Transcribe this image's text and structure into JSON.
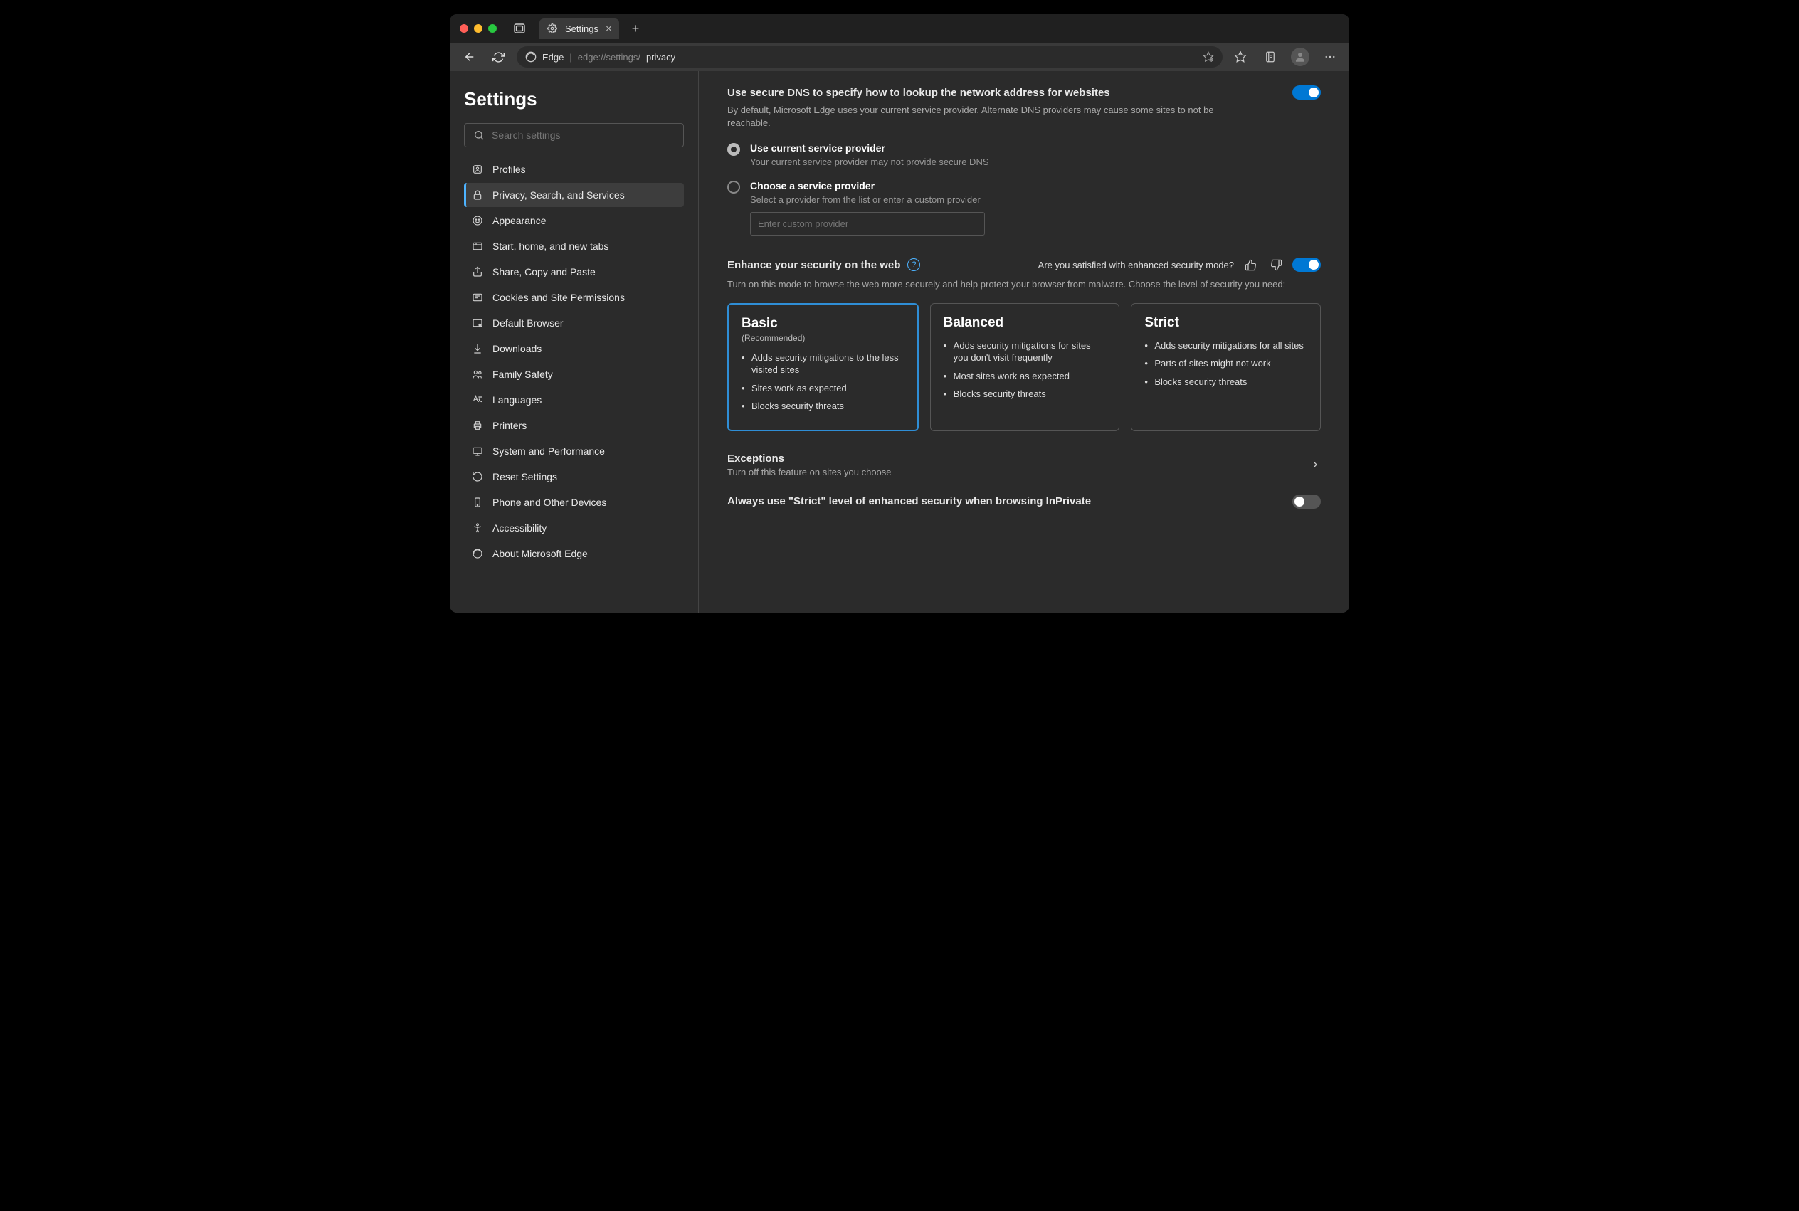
{
  "window": {
    "tab_title": "Settings",
    "app_label": "Edge",
    "url_prefix": "edge://settings/",
    "url_suffix": "privacy"
  },
  "sidebar": {
    "heading": "Settings",
    "search_placeholder": "Search settings",
    "items": [
      {
        "icon": "profile-icon",
        "label": "Profiles"
      },
      {
        "icon": "lock-icon",
        "label": "Privacy, Search, and Services",
        "active": true
      },
      {
        "icon": "appearance-icon",
        "label": "Appearance"
      },
      {
        "icon": "tabs-icon",
        "label": "Start, home, and new tabs"
      },
      {
        "icon": "share-icon",
        "label": "Share, Copy and Paste"
      },
      {
        "icon": "cookies-icon",
        "label": "Cookies and Site Permissions"
      },
      {
        "icon": "browser-icon",
        "label": "Default Browser"
      },
      {
        "icon": "download-icon",
        "label": "Downloads"
      },
      {
        "icon": "family-icon",
        "label": "Family Safety"
      },
      {
        "icon": "language-icon",
        "label": "Languages"
      },
      {
        "icon": "printer-icon",
        "label": "Printers"
      },
      {
        "icon": "system-icon",
        "label": "System and Performance"
      },
      {
        "icon": "reset-icon",
        "label": "Reset Settings"
      },
      {
        "icon": "phone-icon",
        "label": "Phone and Other Devices"
      },
      {
        "icon": "accessibility-icon",
        "label": "Accessibility"
      },
      {
        "icon": "edge-icon",
        "label": "About Microsoft Edge"
      }
    ]
  },
  "dns": {
    "title": "Use secure DNS to specify how to lookup the network address for websites",
    "desc": "By default, Microsoft Edge uses your current service provider. Alternate DNS providers may cause some sites to not be reachable.",
    "toggle_on": true,
    "options": [
      {
        "title": "Use current service provider",
        "desc": "Your current service provider may not provide secure DNS",
        "selected": true
      },
      {
        "title": "Choose a service provider",
        "desc": "Select a provider from the list or enter a custom provider",
        "selected": false,
        "placeholder": "Enter custom provider"
      }
    ]
  },
  "enhance": {
    "title": "Enhance your security on the web",
    "feedback_text": "Are you satisfied with enhanced security mode?",
    "toggle_on": true,
    "desc": "Turn on this mode to browse the web more securely and help protect your browser from malware. Choose the level of security you need:",
    "cards": [
      {
        "title": "Basic",
        "sub": "(Recommended)",
        "selected": true,
        "points": [
          "Adds security mitigations to the less visited sites",
          "Sites work as expected",
          "Blocks security threats"
        ]
      },
      {
        "title": "Balanced",
        "sub": "",
        "selected": false,
        "points": [
          "Adds security mitigations for sites you don't visit frequently",
          "Most sites work as expected",
          "Blocks security threats"
        ]
      },
      {
        "title": "Strict",
        "sub": "",
        "selected": false,
        "points": [
          "Adds security mitigations for all sites",
          "Parts of sites might not work",
          "Blocks security threats"
        ]
      }
    ],
    "exceptions": {
      "title": "Exceptions",
      "desc": "Turn off this feature on sites you choose"
    },
    "inprivate": {
      "title": "Always use \"Strict\" level of enhanced security when browsing InPrivate",
      "on": false
    }
  }
}
